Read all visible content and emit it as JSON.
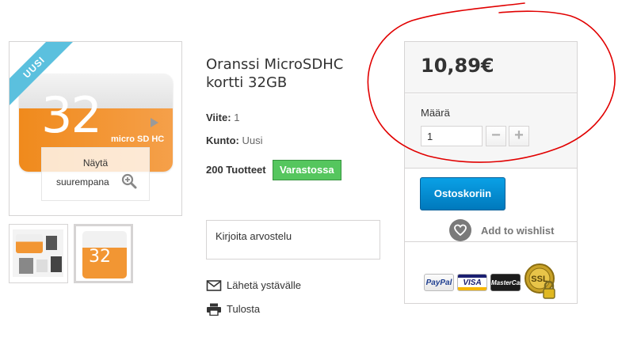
{
  "product": {
    "badge": "UUSI",
    "title": "Oranssi MicroSDHC kortti 32GB",
    "image_card_number": "32",
    "image_card_brand": "micro SD HC",
    "zoom_line1": "Näytä",
    "zoom_line2": "suurempana",
    "thumb_card_number": "32",
    "reference_label": "Viite:",
    "reference_value": "1",
    "condition_label": "Kunto:",
    "condition_value": "Uusi",
    "stock_count": "200 Tuotteet",
    "stock_status": "Varastossa",
    "stock_status_color": "#55c65e"
  },
  "review": {
    "label": "Kirjoita arvostelu"
  },
  "actions": {
    "send_to_friend": "Lähetä ystävälle",
    "print": "Tulosta"
  },
  "buy_box": {
    "price": "10,89€",
    "quantity_label": "Määrä",
    "quantity_value": "1",
    "minus_symbol": "−",
    "plus_symbol": "+",
    "add_to_cart": "Ostoskoriin",
    "add_to_cart_color": "#0089d0",
    "wishlist": "Add to wishlist",
    "payment_methods": [
      "PayPal",
      "VISA",
      "MasterCard",
      "SSL"
    ]
  },
  "icons": {
    "zoom": "magnifier-plus-icon",
    "envelope": "envelope-icon",
    "printer": "printer-icon",
    "heart": "heart-icon",
    "lock": "padlock-icon"
  },
  "annotation": {
    "type": "freehand-circle",
    "color": "#e10000"
  }
}
